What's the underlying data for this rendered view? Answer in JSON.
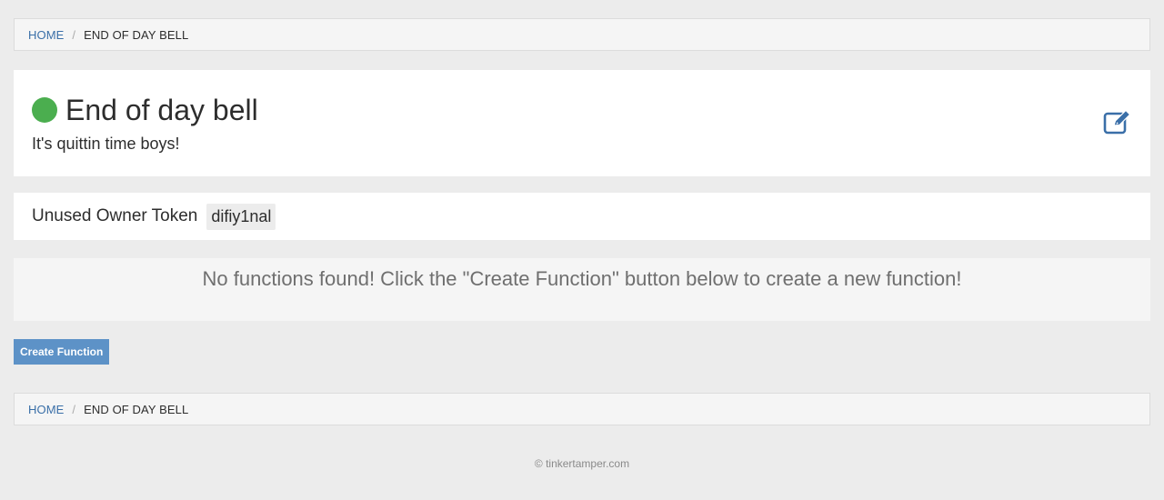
{
  "breadcrumb": {
    "home_label": "HOME",
    "separator": "/",
    "current_label": "END OF DAY BELL"
  },
  "device": {
    "title": "End of day bell",
    "description": "It's quittin time boys!",
    "status_color": "#4bae4f",
    "edit_icon": "edit-icon"
  },
  "token": {
    "label": "Unused Owner Token",
    "value": "difiy1nal"
  },
  "functions": {
    "empty_message": "No functions found! Click the \"Create Function\" button below to create a new function!"
  },
  "actions": {
    "create_function_label": "Create Function"
  },
  "footer": {
    "copyright": "© tinkertamper.com"
  },
  "colors": {
    "accent": "#5d92c7",
    "link": "#3a6fa8",
    "status_online": "#4bae4f"
  }
}
